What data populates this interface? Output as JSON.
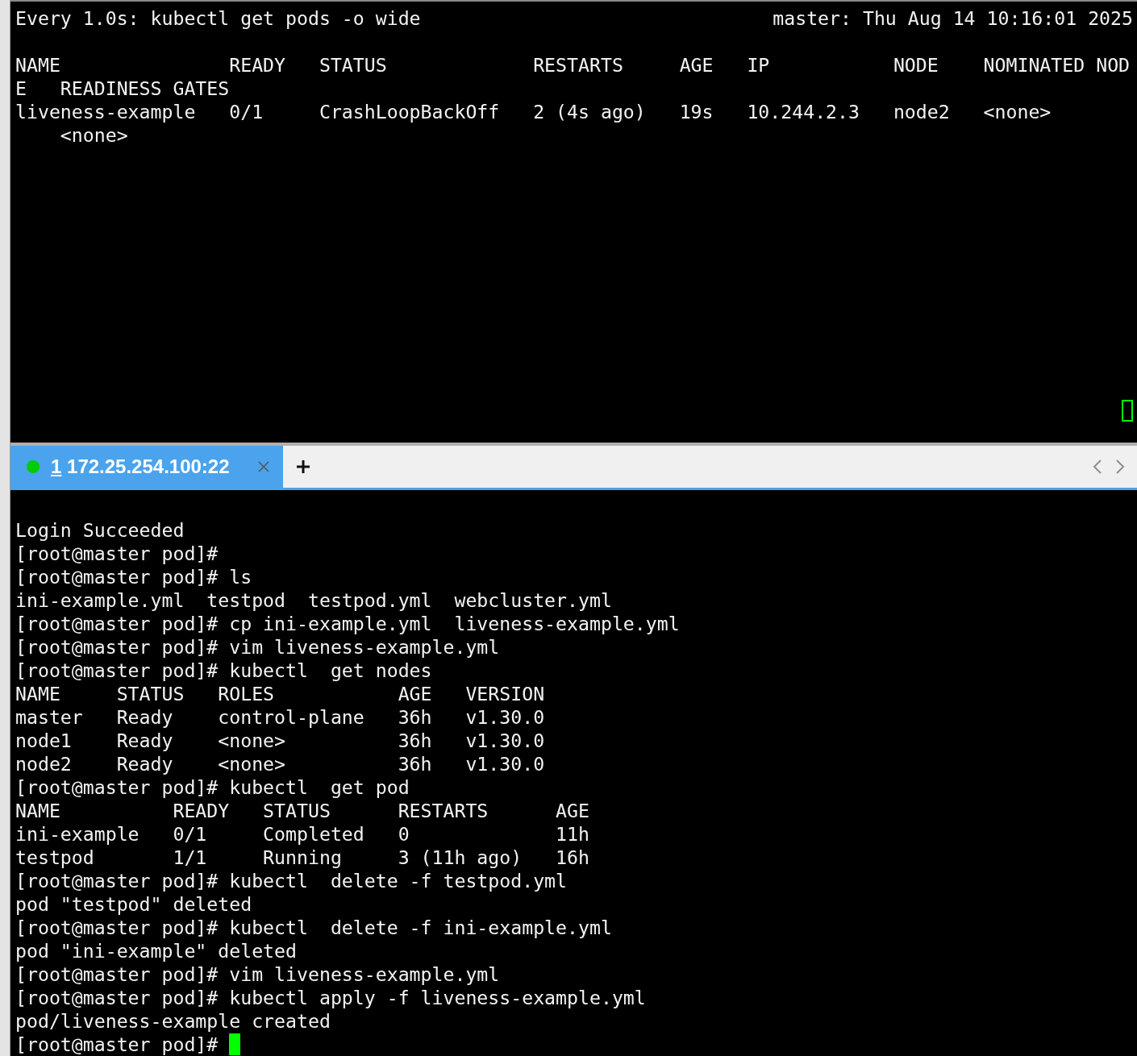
{
  "top_pane": {
    "header_command": "Every 1.0s: kubectl get pods -o wide",
    "header_status": "master: Thu Aug 14 10:16:01 2025",
    "lines": [
      "NAME               READY   STATUS             RESTARTS     AGE   IP           NODE    NOMINATED NOD",
      "E   READINESS GATES",
      "liveness-example   0/1     CrashLoopBackOff   2 (4s ago)   19s   10.244.2.3   node2   <none>",
      "    <none>"
    ],
    "cursor": {
      "focused": false
    }
  },
  "tab_bar": {
    "tabs": [
      {
        "number": "1",
        "label": "172.25.254.100:22",
        "selected": true,
        "connected": true
      }
    ]
  },
  "bottom_pane": {
    "lines": [
      "Login Succeeded",
      "[root@master pod]#",
      "[root@master pod]# ls",
      "ini-example.yml  testpod  testpod.yml  webcluster.yml",
      "[root@master pod]# cp ini-example.yml  liveness-example.yml",
      "[root@master pod]# vim liveness-example.yml",
      "[root@master pod]# kubectl  get nodes",
      "NAME     STATUS   ROLES           AGE   VERSION",
      "master   Ready    control-plane   36h   v1.30.0",
      "node1    Ready    <none>          36h   v1.30.0",
      "node2    Ready    <none>          36h   v1.30.0",
      "[root@master pod]# kubectl  get pod",
      "NAME          READY   STATUS      RESTARTS      AGE",
      "ini-example   0/1     Completed   0             11h",
      "testpod       1/1     Running     3 (11h ago)   16h",
      "[root@master pod]# kubectl  delete -f testpod.yml",
      "pod \"testpod\" deleted",
      "[root@master pod]# kubectl  delete -f ini-example.yml",
      "pod \"ini-example\" deleted",
      "[root@master pod]# vim liveness-example.yml",
      "[root@master pod]# kubectl apply -f liveness-example.yml",
      "pod/liveness-example created",
      "[root@master pod]#"
    ],
    "cursor": {
      "focused": true
    }
  }
}
